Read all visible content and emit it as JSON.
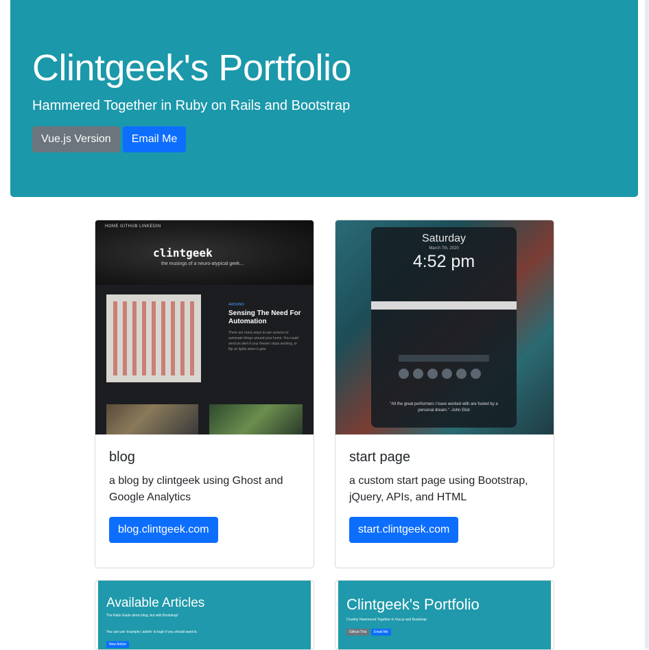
{
  "header": {
    "title": "Clintgeek's Portfolio",
    "subtitle": "Hammered Together in Ruby on Rails and Bootstrap",
    "buttons": {
      "vue": "Vue.js Version",
      "email": "Email Me"
    }
  },
  "cards": [
    {
      "title": "blog",
      "text": "a blog by clintgeek using Ghost and Google Analytics",
      "link": "blog.clintgeek.com",
      "thumb": {
        "nav": "HOME   GITHUB   LINKEDIN",
        "logo": "clintgeek",
        "tagline": "the musings of a neuro-atypical geek...",
        "tag": "ARDUINO",
        "post_title": "Sensing The Need For Automation",
        "excerpt": "There are many ways to use sensors to automate things around your home. You could send an alert if your freezer stops working, or flip on lights when it gets"
      }
    },
    {
      "title": "start page",
      "text": "a custom start page using Bootstrap, jQuery, APIs, and HTML",
      "link": "start.clintgeek.com",
      "thumb": {
        "day": "Saturday",
        "date": "March 7th, 2020",
        "time": "4:52 pm",
        "quote": "\"All the great performers I have worked with are fueled by a personal dream.\" -John Eliot"
      }
    },
    {
      "thumb": {
        "heading": "Available Articles",
        "sub": "The Rails Guide demo blog, but with Bootstrap!",
        "note": "You can use 'example | admin' to login if you should want to.",
        "button": "New Article"
      }
    },
    {
      "thumb": {
        "heading": "Clintgeek's Portfolio",
        "sub": "Crudely Hammered Together in Vue.js and Bootstrap",
        "button1": "Github This",
        "button2": "Email Me"
      }
    }
  ],
  "colors": {
    "jumbotron": "#1b98aa",
    "primary": "#0d6efd",
    "secondary": "#6c757d"
  }
}
